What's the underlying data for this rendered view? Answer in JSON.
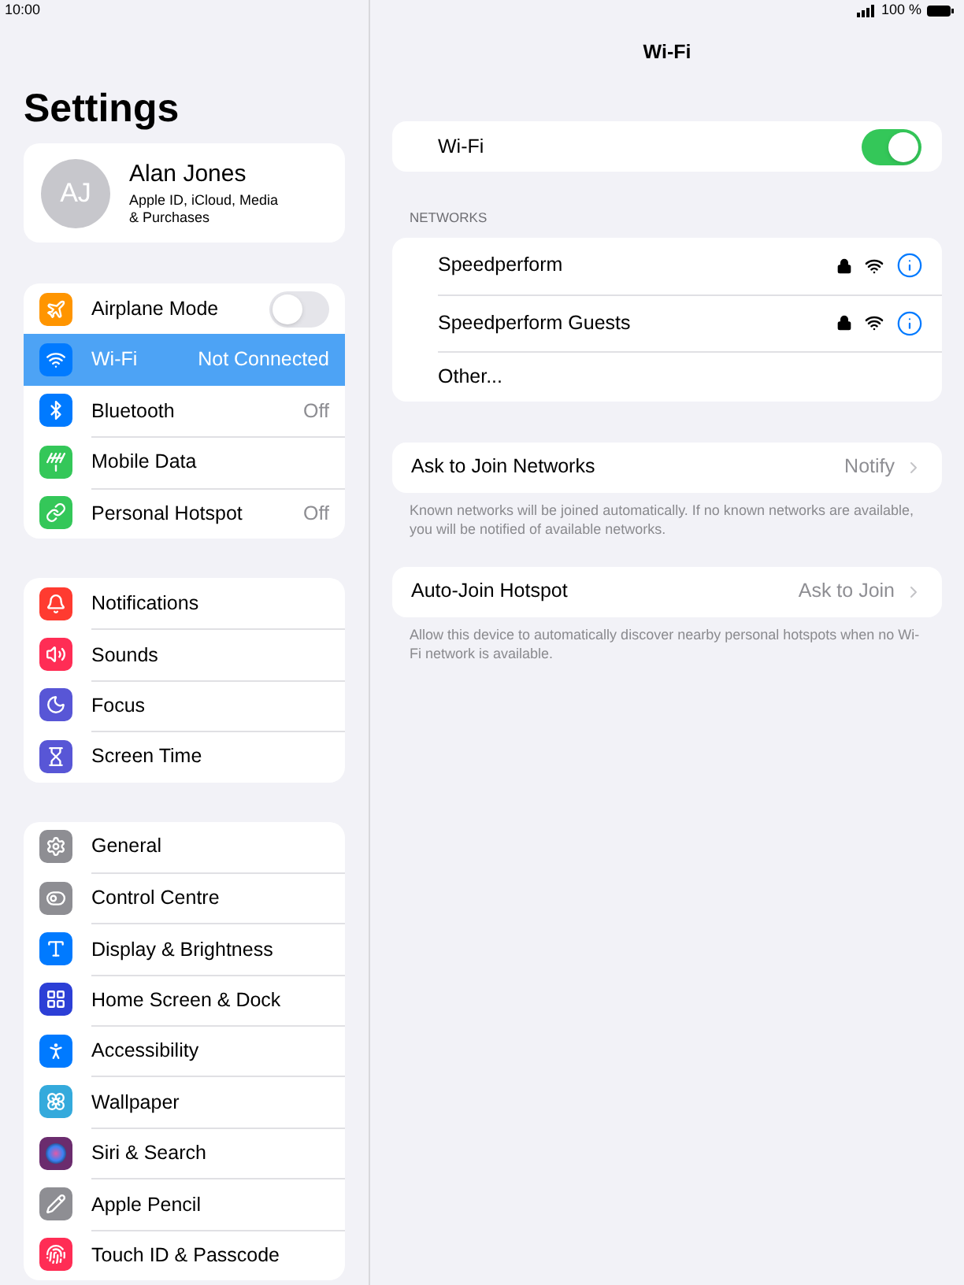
{
  "status_bar": {
    "time": "10:00",
    "battery": "100 %"
  },
  "sidebar": {
    "title": "Settings",
    "profile": {
      "initials": "AJ",
      "name": "Alan Jones",
      "subtitle": "Apple ID, iCloud, Media\n& Purchases"
    },
    "groups": [
      {
        "items": [
          {
            "kind": "toggle",
            "label": "Airplane Mode",
            "on": false,
            "selected": false,
            "color": "#ff9500"
          },
          {
            "kind": "link",
            "label": "Wi-Fi",
            "value": "Not Connected",
            "selected": true,
            "color": "#007aff"
          },
          {
            "kind": "link",
            "label": "Bluetooth",
            "value": "Off",
            "selected": false,
            "color": "#007aff"
          },
          {
            "kind": "link",
            "label": "Mobile Data",
            "selected": false,
            "color": "#34c759"
          },
          {
            "kind": "link",
            "label": "Personal Hotspot",
            "value": "Off",
            "selected": false,
            "color": "#34c759"
          }
        ]
      },
      {
        "items": [
          {
            "kind": "link",
            "label": "Notifications",
            "selected": false,
            "color": "#ff3b30"
          },
          {
            "kind": "link",
            "label": "Sounds",
            "selected": false,
            "color": "#ff2d55"
          },
          {
            "kind": "link",
            "label": "Focus",
            "selected": false,
            "color": "#5856d6"
          },
          {
            "kind": "link",
            "label": "Screen Time",
            "selected": false,
            "color": "#5856d6"
          }
        ]
      },
      {
        "items": [
          {
            "kind": "link",
            "label": "General",
            "selected": false,
            "color": "#8e8e93"
          },
          {
            "kind": "link",
            "label": "Control Centre",
            "selected": false,
            "color": "#8e8e93"
          },
          {
            "kind": "link",
            "label": "Display & Brightness",
            "selected": false,
            "color": "#007aff"
          },
          {
            "kind": "link",
            "label": "Home Screen & Dock",
            "selected": false,
            "color": "#2c3fd6"
          },
          {
            "kind": "link",
            "label": "Accessibility",
            "selected": false,
            "color": "#007aff"
          },
          {
            "kind": "link",
            "label": "Wallpaper",
            "selected": false,
            "color": "#34aadc"
          },
          {
            "kind": "link",
            "label": "Siri & Search",
            "selected": false,
            "color": "#6b2c6e"
          },
          {
            "kind": "link",
            "label": "Apple Pencil",
            "selected": false,
            "color": "#8e8e93"
          },
          {
            "kind": "link",
            "label": "Touch ID & Passcode",
            "selected": false,
            "color": "#ff2d55"
          }
        ]
      }
    ]
  },
  "detail": {
    "title": "Wi-Fi",
    "wifi_toggle": {
      "label": "Wi-Fi",
      "on": true
    },
    "networks_header": "NETWORKS",
    "networks": [
      {
        "kind": "network",
        "name": "Speedperform",
        "locked": true
      },
      {
        "kind": "network",
        "name": "Speedperform Guests",
        "locked": true
      },
      {
        "kind": "other",
        "name": "Other..."
      }
    ],
    "options": [
      {
        "label": "Ask to Join Networks",
        "value": "Notify",
        "footer": "Known networks will be joined automatically. If no known networks are available, you will be notified of available networks."
      },
      {
        "label": "Auto-Join Hotspot",
        "value": "Ask to Join",
        "footer": "Allow this device to automatically discover nearby personal hotspots when no Wi-Fi network is available."
      }
    ]
  }
}
